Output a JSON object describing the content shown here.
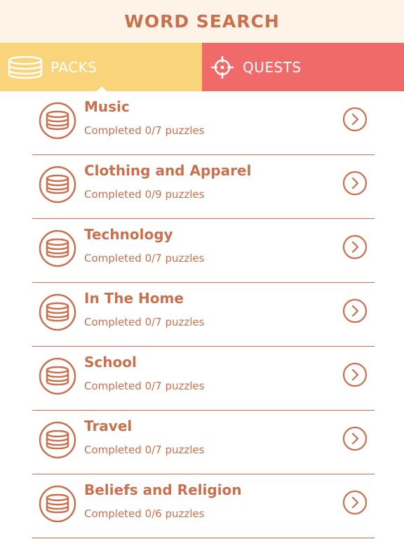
{
  "colors": {
    "accent": "#c9714e",
    "header_bg": "#fdf3e6",
    "packs_tab": "#f9d47a",
    "quests_tab": "#f06a6a"
  },
  "header": {
    "title": "WORD SEARCH"
  },
  "tabs": [
    {
      "label": "PACKS",
      "icon": "coin-stack-icon",
      "selected": true
    },
    {
      "label": "QUESTS",
      "icon": "crosshair-icon",
      "selected": false
    }
  ],
  "packs": [
    {
      "name": "Music",
      "progress": "Completed 0/7 puzzles"
    },
    {
      "name": "Clothing and Apparel",
      "progress": "Completed 0/9 puzzles"
    },
    {
      "name": "Technology",
      "progress": "Completed 0/7 puzzles"
    },
    {
      "name": "In The Home",
      "progress": "Completed 0/7 puzzles"
    },
    {
      "name": "School",
      "progress": "Completed 0/7 puzzles"
    },
    {
      "name": "Travel",
      "progress": "Completed 0/7 puzzles"
    },
    {
      "name": "Beliefs and Religion",
      "progress": "Completed 0/6 puzzles"
    }
  ]
}
